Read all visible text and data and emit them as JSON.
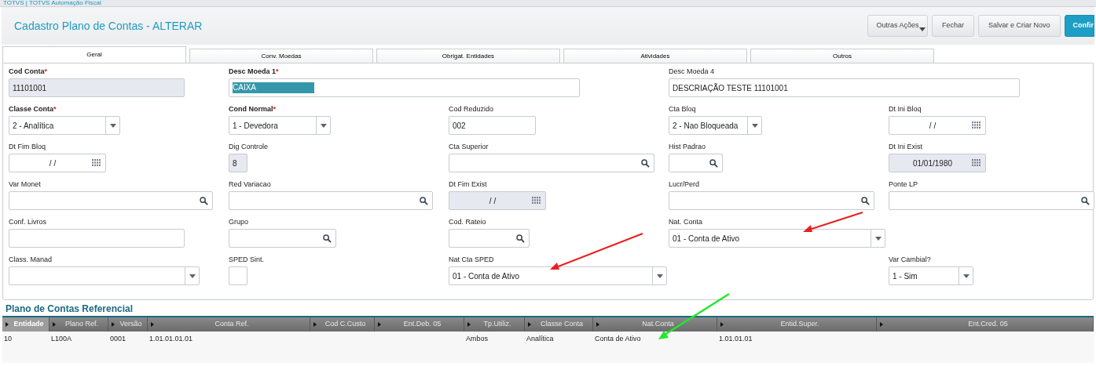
{
  "app_bar": {
    "title": "TOTVS | TOTVS Automação Fiscal"
  },
  "header": {
    "title": "Cadastro Plano de Contas - ALTERAR",
    "buttons": [
      {
        "label": "Outras Ações",
        "kind": "menu"
      },
      {
        "label": "Fechar",
        "kind": "plain"
      },
      {
        "label": "Salvar e Criar Novo",
        "kind": "plain"
      },
      {
        "label": "Confir",
        "kind": "primary"
      }
    ]
  },
  "tabs": [
    {
      "label": "Geral",
      "selected": true
    },
    {
      "label": "Conv. Moedas",
      "selected": false
    },
    {
      "label": "Obrigat. Entidades",
      "selected": false
    },
    {
      "label": "Atividades",
      "selected": false
    },
    {
      "label": "Outros",
      "selected": false
    }
  ],
  "form_rows": [
    [
      {
        "label": "Cod Conta",
        "required_mark": "*",
        "kind": "text",
        "value": "11101001",
        "disabled": true
      },
      {
        "label": "Desc Moeda 1",
        "required_mark": "*",
        "kind": "text",
        "value": "CAIXA",
        "disabled": false,
        "highlighted": true
      },
      {
        "label": "Desc Moeda 4",
        "kind": "text",
        "value": "DESCRIAÇÃO TESTE 11101001",
        "disabled": false
      }
    ],
    [
      {
        "label": "Classe Conta",
        "required_mark": "*",
        "kind": "select",
        "value": "2 - Analítica",
        "disabled": false
      },
      {
        "label": "Cond Normal",
        "required_mark": "*",
        "kind": "select",
        "value": "1 - Devedora",
        "disabled": false
      },
      {
        "label": "Cod Reduzido",
        "kind": "text",
        "value": "002",
        "disabled": false
      },
      {
        "label": "Cta Bloq",
        "kind": "select",
        "value": "2 - Nao Bloqueada",
        "disabled": false
      },
      {
        "label": "Dt Ini Bloq",
        "kind": "date",
        "value": "/ /",
        "disabled": false
      }
    ],
    [
      {
        "label": "Dt Fim Bloq",
        "kind": "date",
        "value": "/ /",
        "disabled": false
      },
      {
        "label": "Dig Controle",
        "kind": "text",
        "value": "8",
        "disabled": true
      },
      {
        "label": "Cta Superior",
        "kind": "lookup",
        "disabled": false
      },
      {
        "label": "Hist Padrao",
        "kind": "lookup",
        "disabled": false
      },
      {
        "label": "Dt Ini Exist",
        "kind": "date",
        "value": "01/01/1980",
        "disabled": true
      }
    ],
    [
      {
        "label": "Var Monet",
        "kind": "lookup",
        "disabled": false
      },
      {
        "label": "Red Variacao",
        "kind": "lookup",
        "disabled": false
      },
      {
        "label": "Dt Fim Exist",
        "kind": "date",
        "value": "/ /",
        "disabled": true
      },
      {
        "label": "Lucr/Perd",
        "kind": "lookup",
        "disabled": false
      },
      {
        "label": "Ponte LP",
        "kind": "lookup",
        "disabled": false
      }
    ],
    [
      {
        "label": "Conf. Livros",
        "kind": "text",
        "disabled": false
      },
      {
        "label": "Grupo",
        "kind": "lookup",
        "disabled": false
      },
      {
        "label": "Cod. Rateio",
        "kind": "lookup",
        "disabled": false
      },
      {
        "label": "Nat. Conta",
        "kind": "select",
        "value": "01 - Conta de Ativo",
        "disabled": false
      }
    ],
    [
      {
        "label": "Class. Manad",
        "kind": "select",
        "disabled": false
      },
      {
        "label": "SPED Sint.",
        "kind": "check",
        "disabled": false
      },
      {
        "label": "Nat Cta SPED",
        "kind": "select",
        "value": "01 - Conta de Ativo",
        "disabled": false
      },
      {
        "label": "Var Cambial?",
        "kind": "select",
        "value": "1 - Sim",
        "disabled": false
      }
    ]
  ],
  "grid": {
    "title": "Plano de Contas Referencial",
    "columns": [
      {
        "label": "Entidade",
        "selected": true
      },
      {
        "label": "Plano Ref.",
        "selected": false
      },
      {
        "label": "Versão",
        "selected": false
      },
      {
        "label": "Conta Ref.",
        "selected": false
      },
      {
        "label": "Cod C.Custo",
        "selected": false
      },
      {
        "label": "Ent.Deb. 05",
        "selected": false
      },
      {
        "label": "Tp.Utiliz.",
        "selected": false
      },
      {
        "label": "Classe Conta",
        "selected": false
      },
      {
        "label": "Nat.Conta",
        "selected": false
      },
      {
        "label": "Entid.Super.",
        "selected": false
      },
      {
        "label": "Ent.Cred. 05",
        "selected": false
      }
    ],
    "rows": [
      [
        "10",
        "L100A",
        "0001",
        "1.01.01.01.01",
        "",
        "",
        "Ambos",
        "Analítica",
        "Conta de Ativo",
        "1.01.01.01",
        ""
      ]
    ]
  }
}
